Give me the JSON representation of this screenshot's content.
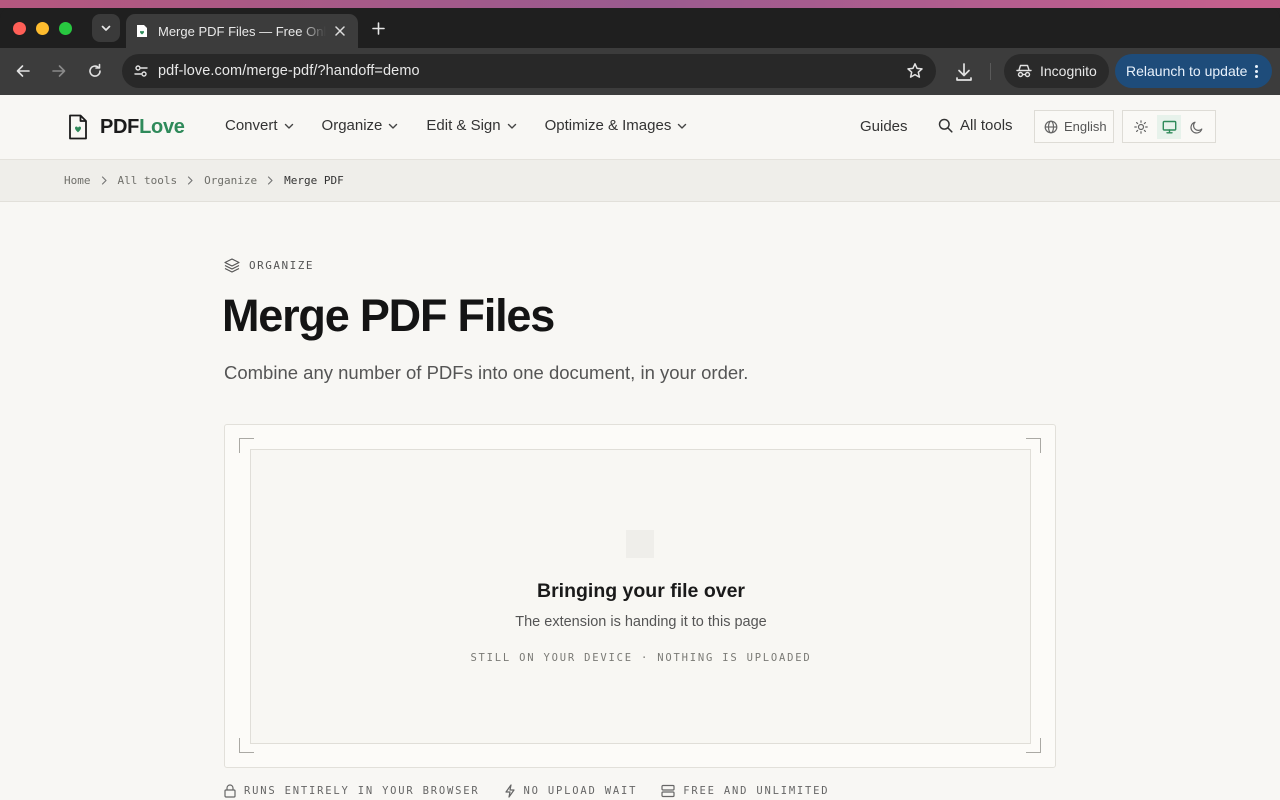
{
  "browser": {
    "tab_title": "Merge PDF Files — Free Online",
    "url": "pdf-love.com/merge-pdf/?handoff=demo",
    "incognito_label": "Incognito",
    "relaunch_label": "Relaunch to update"
  },
  "site": {
    "logo_prefix": "PDF",
    "logo_suffix": "Love",
    "nav": [
      {
        "label": "Convert"
      },
      {
        "label": "Organize"
      },
      {
        "label": "Edit & Sign"
      },
      {
        "label": "Optimize & Images"
      }
    ],
    "guides_label": "Guides",
    "all_tools_label": "All tools",
    "language": "English"
  },
  "breadcrumb": [
    "Home",
    "All tools",
    "Organize",
    "Merge PDF"
  ],
  "hero": {
    "kicker": "ORGANIZE",
    "title": "Merge PDF Files",
    "subtitle": "Combine any number of PDFs into one document, in your order."
  },
  "dropzone": {
    "title": "Bringing your file over",
    "subtitle": "The extension is handing it to this page",
    "note": "STILL ON YOUR DEVICE · NOTHING IS UPLOADED"
  },
  "features": [
    {
      "label": "RUNS ENTIRELY IN YOUR BROWSER",
      "icon": "lock-icon"
    },
    {
      "label": "NO UPLOAD WAIT",
      "icon": "bolt-icon"
    },
    {
      "label": "FREE AND UNLIMITED",
      "icon": "server-icon"
    }
  ],
  "colors": {
    "brand_accent": "#2f8a5a",
    "page_bg": "#f8f7f4",
    "relaunch_bg": "#1e4c7a"
  }
}
